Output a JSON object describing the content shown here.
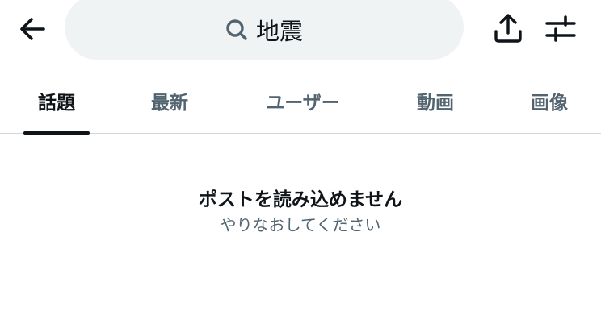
{
  "header": {
    "back_icon": "arrow-left-icon",
    "search": {
      "icon": "search-icon",
      "query": "地震"
    },
    "share_icon": "share-upload-icon",
    "filter_icon": "sliders-filter-icon"
  },
  "tabs": [
    {
      "label": "話題",
      "active": true
    },
    {
      "label": "最新",
      "active": false
    },
    {
      "label": "ユーザー",
      "active": false
    },
    {
      "label": "動画",
      "active": false
    },
    {
      "label": "画像",
      "active": false
    }
  ],
  "empty_state": {
    "title": "ポストを読み込めません",
    "subtitle": "やりなおしてください"
  },
  "colors": {
    "text_primary": "#0f1419",
    "text_secondary": "#536471",
    "search_bg": "#eff3f4",
    "divider": "#cfd9de"
  }
}
